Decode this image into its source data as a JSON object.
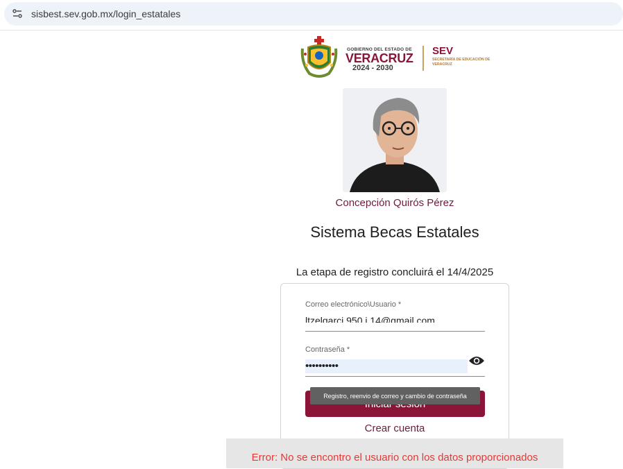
{
  "browser": {
    "url": "sisbest.sev.gob.mx/login_estatales"
  },
  "header": {
    "gobierno_label": "GOBIERNO DEL ESTADO DE",
    "state_name": "VERACRUZ",
    "period": "2024 - 2030",
    "sev_acronym": "SEV",
    "sev_full": "SECRETARÍA DE EDUCACIÓN DE VERACRUZ"
  },
  "portrait": {
    "name": "Concepción Quirós Pérez"
  },
  "main": {
    "title": "Sistema Becas Estatales",
    "deadline_text": "La etapa de registro concluirá el 14/4/2025"
  },
  "login_form": {
    "email_label": "Correo electrónico\\Usuario *",
    "email_value": "ltzelgarci 950 i 14@gmail.com",
    "password_label": "Contraseña *",
    "password_value": "••••••••••",
    "login_button": "Iniciar sesión",
    "tooltip": "Registro, reenvio de correo y cambio de contraseña",
    "create_account": "Crear cuenta"
  },
  "error": {
    "message": "Error: No se encontro el usuario con los datos proporcionados"
  },
  "colors": {
    "brand": "#8b1538",
    "brand_text": "#6d1a3d",
    "error": "#e53935",
    "autofill": "#e8f0fe"
  },
  "icons": {
    "site_info": "tune-icon",
    "password_toggle": "eye-icon"
  }
}
